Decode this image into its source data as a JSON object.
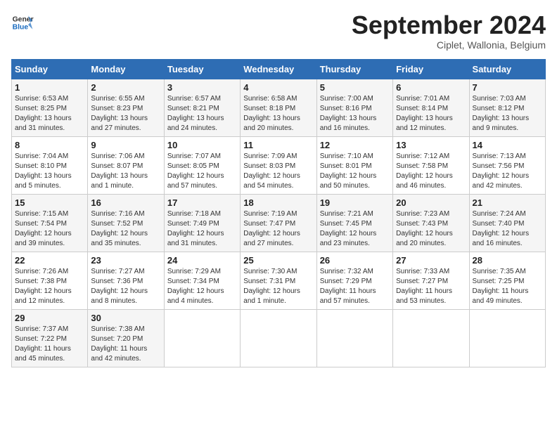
{
  "header": {
    "logo_line1": "General",
    "logo_line2": "Blue",
    "month": "September 2024",
    "location": "Ciplet, Wallonia, Belgium"
  },
  "days_of_week": [
    "Sunday",
    "Monday",
    "Tuesday",
    "Wednesday",
    "Thursday",
    "Friday",
    "Saturday"
  ],
  "weeks": [
    [
      {
        "day": "1",
        "info": "Sunrise: 6:53 AM\nSunset: 8:25 PM\nDaylight: 13 hours\nand 31 minutes."
      },
      {
        "day": "2",
        "info": "Sunrise: 6:55 AM\nSunset: 8:23 PM\nDaylight: 13 hours\nand 27 minutes."
      },
      {
        "day": "3",
        "info": "Sunrise: 6:57 AM\nSunset: 8:21 PM\nDaylight: 13 hours\nand 24 minutes."
      },
      {
        "day": "4",
        "info": "Sunrise: 6:58 AM\nSunset: 8:18 PM\nDaylight: 13 hours\nand 20 minutes."
      },
      {
        "day": "5",
        "info": "Sunrise: 7:00 AM\nSunset: 8:16 PM\nDaylight: 13 hours\nand 16 minutes."
      },
      {
        "day": "6",
        "info": "Sunrise: 7:01 AM\nSunset: 8:14 PM\nDaylight: 13 hours\nand 12 minutes."
      },
      {
        "day": "7",
        "info": "Sunrise: 7:03 AM\nSunset: 8:12 PM\nDaylight: 13 hours\nand 9 minutes."
      }
    ],
    [
      {
        "day": "8",
        "info": "Sunrise: 7:04 AM\nSunset: 8:10 PM\nDaylight: 13 hours\nand 5 minutes."
      },
      {
        "day": "9",
        "info": "Sunrise: 7:06 AM\nSunset: 8:07 PM\nDaylight: 13 hours\nand 1 minute."
      },
      {
        "day": "10",
        "info": "Sunrise: 7:07 AM\nSunset: 8:05 PM\nDaylight: 12 hours\nand 57 minutes."
      },
      {
        "day": "11",
        "info": "Sunrise: 7:09 AM\nSunset: 8:03 PM\nDaylight: 12 hours\nand 54 minutes."
      },
      {
        "day": "12",
        "info": "Sunrise: 7:10 AM\nSunset: 8:01 PM\nDaylight: 12 hours\nand 50 minutes."
      },
      {
        "day": "13",
        "info": "Sunrise: 7:12 AM\nSunset: 7:58 PM\nDaylight: 12 hours\nand 46 minutes."
      },
      {
        "day": "14",
        "info": "Sunrise: 7:13 AM\nSunset: 7:56 PM\nDaylight: 12 hours\nand 42 minutes."
      }
    ],
    [
      {
        "day": "15",
        "info": "Sunrise: 7:15 AM\nSunset: 7:54 PM\nDaylight: 12 hours\nand 39 minutes."
      },
      {
        "day": "16",
        "info": "Sunrise: 7:16 AM\nSunset: 7:52 PM\nDaylight: 12 hours\nand 35 minutes."
      },
      {
        "day": "17",
        "info": "Sunrise: 7:18 AM\nSunset: 7:49 PM\nDaylight: 12 hours\nand 31 minutes."
      },
      {
        "day": "18",
        "info": "Sunrise: 7:19 AM\nSunset: 7:47 PM\nDaylight: 12 hours\nand 27 minutes."
      },
      {
        "day": "19",
        "info": "Sunrise: 7:21 AM\nSunset: 7:45 PM\nDaylight: 12 hours\nand 23 minutes."
      },
      {
        "day": "20",
        "info": "Sunrise: 7:23 AM\nSunset: 7:43 PM\nDaylight: 12 hours\nand 20 minutes."
      },
      {
        "day": "21",
        "info": "Sunrise: 7:24 AM\nSunset: 7:40 PM\nDaylight: 12 hours\nand 16 minutes."
      }
    ],
    [
      {
        "day": "22",
        "info": "Sunrise: 7:26 AM\nSunset: 7:38 PM\nDaylight: 12 hours\nand 12 minutes."
      },
      {
        "day": "23",
        "info": "Sunrise: 7:27 AM\nSunset: 7:36 PM\nDaylight: 12 hours\nand 8 minutes."
      },
      {
        "day": "24",
        "info": "Sunrise: 7:29 AM\nSunset: 7:34 PM\nDaylight: 12 hours\nand 4 minutes."
      },
      {
        "day": "25",
        "info": "Sunrise: 7:30 AM\nSunset: 7:31 PM\nDaylight: 12 hours\nand 1 minute."
      },
      {
        "day": "26",
        "info": "Sunrise: 7:32 AM\nSunset: 7:29 PM\nDaylight: 11 hours\nand 57 minutes."
      },
      {
        "day": "27",
        "info": "Sunrise: 7:33 AM\nSunset: 7:27 PM\nDaylight: 11 hours\nand 53 minutes."
      },
      {
        "day": "28",
        "info": "Sunrise: 7:35 AM\nSunset: 7:25 PM\nDaylight: 11 hours\nand 49 minutes."
      }
    ],
    [
      {
        "day": "29",
        "info": "Sunrise: 7:37 AM\nSunset: 7:22 PM\nDaylight: 11 hours\nand 45 minutes."
      },
      {
        "day": "30",
        "info": "Sunrise: 7:38 AM\nSunset: 7:20 PM\nDaylight: 11 hours\nand 42 minutes."
      },
      {
        "day": "",
        "info": ""
      },
      {
        "day": "",
        "info": ""
      },
      {
        "day": "",
        "info": ""
      },
      {
        "day": "",
        "info": ""
      },
      {
        "day": "",
        "info": ""
      }
    ]
  ]
}
